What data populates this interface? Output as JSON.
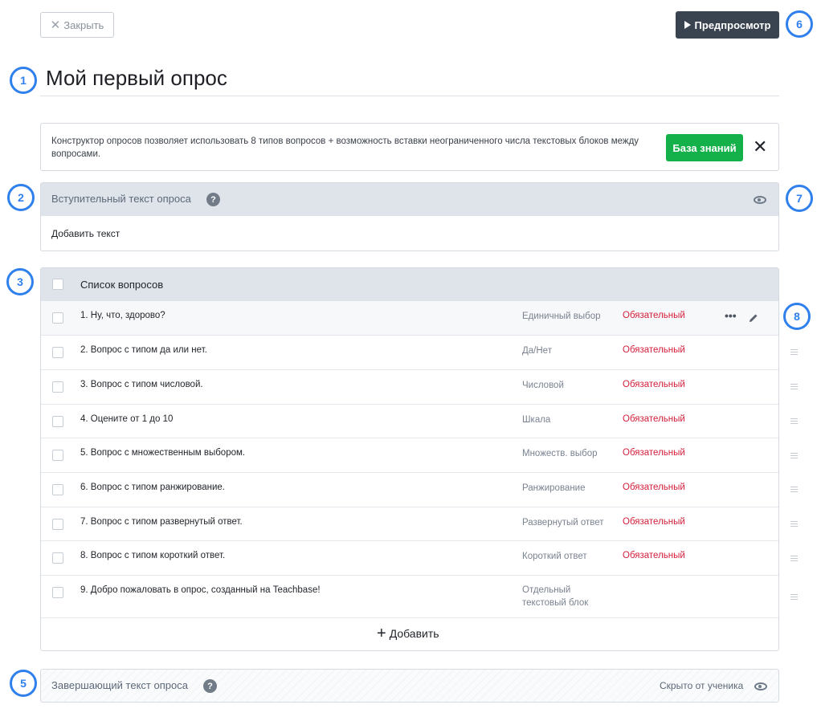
{
  "header": {
    "close_label": "Закрыть",
    "preview_label": "Предпросмотр"
  },
  "page_title": "Мой первый опрос",
  "info": {
    "text": "Конструктор опросов позволяет использовать 8 типов вопросов + возможность вставки неограниченного числа текстовых блоков между вопросами.",
    "kb_button": "База знаний",
    "close_glyph": "✕"
  },
  "intro": {
    "title": "Вступительный текст опроса",
    "add_text": "Добавить текст"
  },
  "questions": {
    "title": "Список вопросов",
    "items": [
      {
        "text": "1. Ну, что, здорово?",
        "type": "Единичный выбор",
        "required": "Обязательный"
      },
      {
        "text": "2. Вопрос с типом да или нет.",
        "type": "Да/Нет",
        "required": "Обязательный"
      },
      {
        "text": "3. Вопрос с типом числовой.",
        "type": "Числовой",
        "required": "Обязательный"
      },
      {
        "text": "4. Оцените от 1 до 10",
        "type": "Шкала",
        "required": "Обязательный"
      },
      {
        "text": "5. Вопрос с множественным выбором.",
        "type": "Множеств. выбор",
        "required": "Обязательный"
      },
      {
        "text": "6. Вопрос с типом ранжирование.",
        "type": "Ранжирование",
        "required": "Обязательный"
      },
      {
        "text": "7. Вопрос с типом развернутый ответ.",
        "type": "Развернутый ответ",
        "required": "Обязательный"
      },
      {
        "text": "8. Вопрос с типом короткий ответ.",
        "type": "Короткий ответ",
        "required": "Обязательный"
      },
      {
        "text": "9. Добро пожаловать в опрос, созданный на Teachbase!",
        "type": "Отдельный текстовый блок",
        "required": ""
      }
    ],
    "add_label": "Добавить"
  },
  "final": {
    "title": "Завершающий текст опроса",
    "hidden_label": "Скрыто от ученика"
  },
  "markers": [
    "1",
    "2",
    "3",
    "4",
    "5",
    "6",
    "7",
    "8"
  ],
  "help_glyph": "?",
  "colors": {
    "accent_marker": "#2f80ed",
    "preview_button": "#3a4350",
    "kb_button": "#14b14b",
    "required": "#d4203b",
    "header_bg": "#dfe4eb"
  }
}
